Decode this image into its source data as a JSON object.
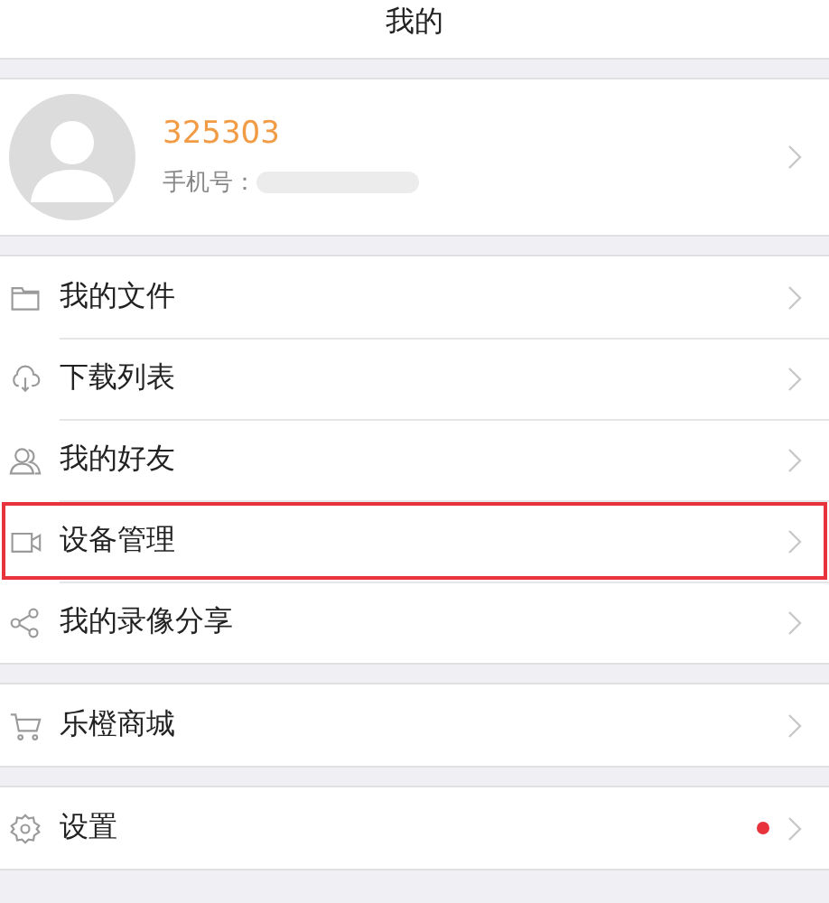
{
  "title": "我的",
  "profile": {
    "user_id": "325303",
    "phone_label": "手机号："
  },
  "groups": [
    {
      "items": [
        {
          "label": "我的文件",
          "highlighted": false,
          "badge": false
        },
        {
          "label": "下载列表",
          "highlighted": false,
          "badge": false
        },
        {
          "label": "我的好友",
          "highlighted": false,
          "badge": false
        },
        {
          "label": "设备管理",
          "highlighted": true,
          "badge": false
        },
        {
          "label": "我的录像分享",
          "highlighted": false,
          "badge": false
        }
      ]
    },
    {
      "items": [
        {
          "label": "乐橙商城",
          "highlighted": false,
          "badge": false
        }
      ]
    },
    {
      "items": [
        {
          "label": "设置",
          "highlighted": false,
          "badge": true
        }
      ]
    }
  ]
}
